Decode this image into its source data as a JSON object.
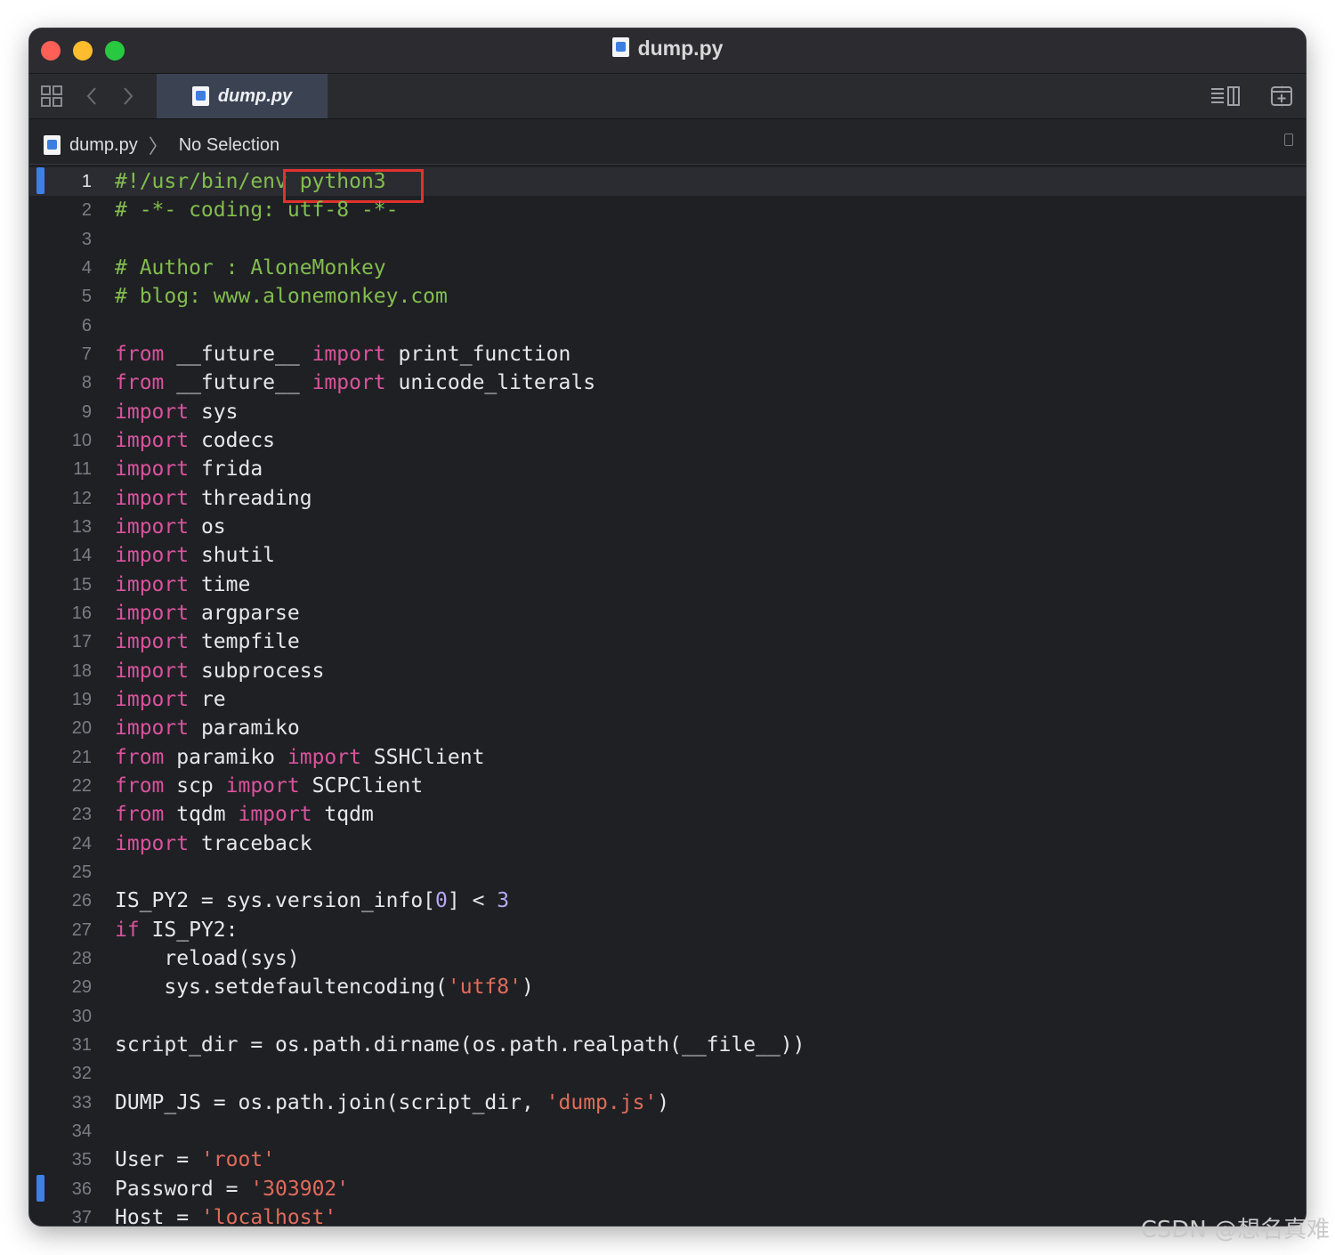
{
  "window": {
    "title": "dump.py"
  },
  "tab": {
    "label": "dump.py"
  },
  "breadcrumb": {
    "file": "dump.py",
    "selection": "No Selection"
  },
  "editor": {
    "highlighted_text": "python3",
    "lines": [
      [
        [
          "#!/usr/bin/env python3",
          "cm"
        ]
      ],
      [
        [
          "# -*- coding: utf-8 -*-",
          "cm"
        ]
      ],
      [],
      [
        [
          "# Author : AloneMonkey",
          "cm"
        ]
      ],
      [
        [
          "# blog: www.alonemonkey.com",
          "cm"
        ]
      ],
      [],
      [
        [
          "from",
          "kw"
        ],
        [
          " __future__ "
        ],
        [
          "import",
          "kw"
        ],
        [
          " print_function"
        ]
      ],
      [
        [
          "from",
          "kw"
        ],
        [
          " __future__ "
        ],
        [
          "import",
          "kw"
        ],
        [
          " unicode_literals"
        ]
      ],
      [
        [
          "import",
          "kw"
        ],
        [
          " sys"
        ]
      ],
      [
        [
          "import",
          "kw"
        ],
        [
          " codecs"
        ]
      ],
      [
        [
          "import",
          "kw"
        ],
        [
          " frida"
        ]
      ],
      [
        [
          "import",
          "kw"
        ],
        [
          " threading"
        ]
      ],
      [
        [
          "import",
          "kw"
        ],
        [
          " os"
        ]
      ],
      [
        [
          "import",
          "kw"
        ],
        [
          " shutil"
        ]
      ],
      [
        [
          "import",
          "kw"
        ],
        [
          " time"
        ]
      ],
      [
        [
          "import",
          "kw"
        ],
        [
          " argparse"
        ]
      ],
      [
        [
          "import",
          "kw"
        ],
        [
          " tempfile"
        ]
      ],
      [
        [
          "import",
          "kw"
        ],
        [
          " subprocess"
        ]
      ],
      [
        [
          "import",
          "kw"
        ],
        [
          " re"
        ]
      ],
      [
        [
          "import",
          "kw"
        ],
        [
          " paramiko"
        ]
      ],
      [
        [
          "from",
          "kw"
        ],
        [
          " paramiko "
        ],
        [
          "import",
          "kw"
        ],
        [
          " SSHClient"
        ]
      ],
      [
        [
          "from",
          "kw"
        ],
        [
          " scp "
        ],
        [
          "import",
          "kw"
        ],
        [
          " SCPClient"
        ]
      ],
      [
        [
          "from",
          "kw"
        ],
        [
          " tqdm "
        ],
        [
          "import",
          "kw"
        ],
        [
          " tqdm"
        ]
      ],
      [
        [
          "import",
          "kw"
        ],
        [
          " traceback"
        ]
      ],
      [],
      [
        [
          "IS_PY2 = sys.version_info["
        ],
        [
          "0",
          "num"
        ],
        [
          "] < "
        ],
        [
          "3",
          "num"
        ]
      ],
      [
        [
          "if",
          "kw"
        ],
        [
          " IS_PY2:"
        ]
      ],
      [
        [
          "    reload(sys)"
        ]
      ],
      [
        [
          "    sys.setdefaultencoding("
        ],
        [
          "'utf8'",
          "str"
        ],
        [
          ")"
        ]
      ],
      [],
      [
        [
          "script_dir = os.path.dirname(os.path.realpath(__file__))"
        ]
      ],
      [],
      [
        [
          "DUMP_JS = os.path.join(script_dir, "
        ],
        [
          "'dump.js'",
          "str"
        ],
        [
          ")"
        ]
      ],
      [],
      [
        [
          "User = "
        ],
        [
          "'root'",
          "str"
        ]
      ],
      [
        [
          "Password = "
        ],
        [
          "'303902'",
          "str"
        ]
      ],
      [
        [
          "Host = "
        ],
        [
          "'localhost'",
          "str"
        ]
      ]
    ]
  },
  "watermark": "CSDN @想名真难",
  "colors": {
    "keyword": "#d9539c",
    "comment": "#82bd4e",
    "string": "#e06c5b",
    "number": "#b7a8f5",
    "highlight_box": "#e0332d",
    "change_bar": "#3f7fe8"
  }
}
